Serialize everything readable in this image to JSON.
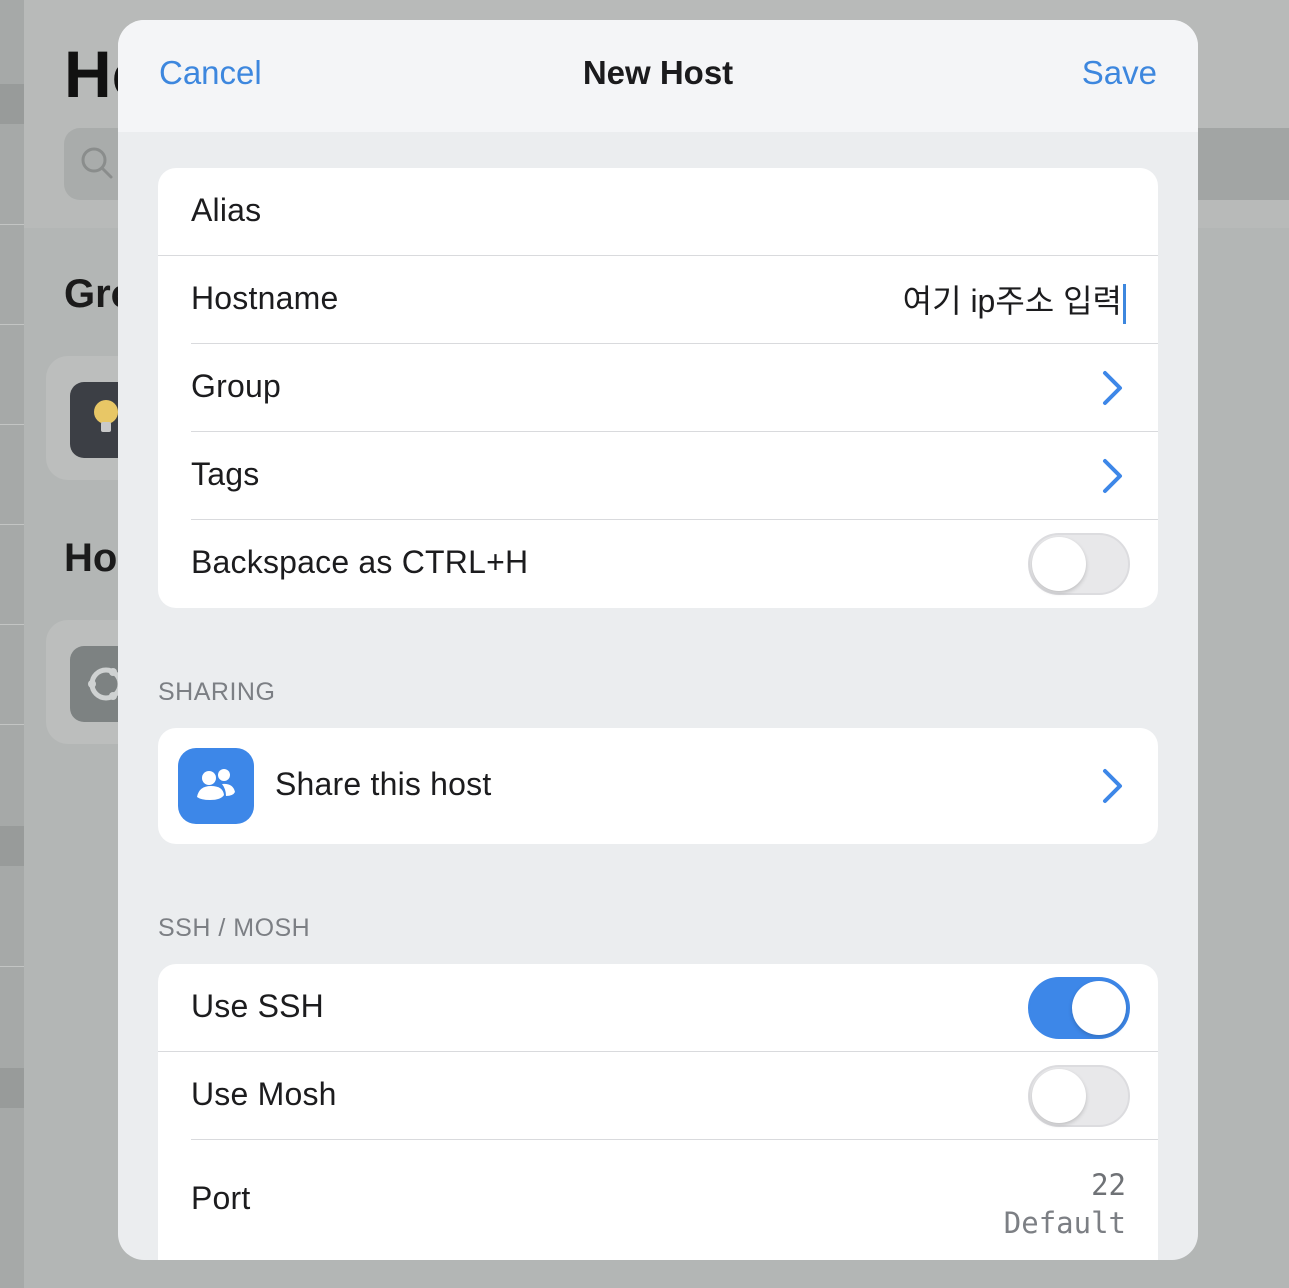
{
  "background": {
    "title_partial": "Hosts",
    "groups_header_partial": "Groups",
    "hosts_header_partial": "Hosts"
  },
  "nav": {
    "cancel_label": "Cancel",
    "title": "New Host",
    "save_label": "Save"
  },
  "main_group": {
    "alias_label": "Alias",
    "hostname_label": "Hostname",
    "hostname_value": "여기 ip주소 입력",
    "group_label": "Group",
    "tags_label": "Tags",
    "backspace_label": "Backspace as CTRL+H",
    "backspace_enabled": false
  },
  "sharing": {
    "header": "SHARING",
    "share_label": "Share this host",
    "share_icon": "people-icon"
  },
  "ssh_mosh": {
    "header": "SSH / MOSH",
    "use_ssh_label": "Use SSH",
    "use_ssh_enabled": true,
    "use_mosh_label": "Use Mosh",
    "use_mosh_enabled": false,
    "port_label": "Port",
    "port_value": "22",
    "port_hint": "Default"
  },
  "colors": {
    "accent": "#3d87e8",
    "modal_bg": "#ebedef",
    "card_bg": "#ffffff"
  }
}
